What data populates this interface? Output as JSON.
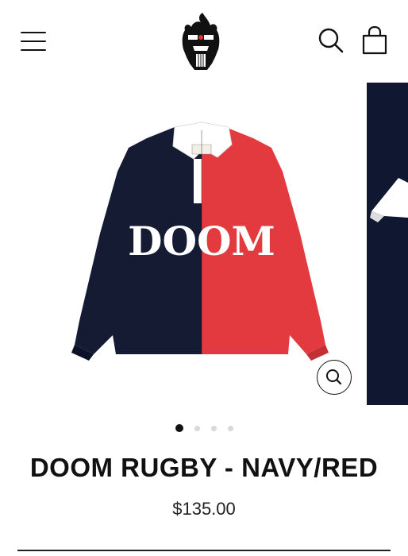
{
  "header": {
    "menu_icon": "hamburger-menu-icon",
    "logo_icon": "doom-mask-logo",
    "search_icon": "search-icon",
    "cart_icon": "shopping-bag-icon"
  },
  "product": {
    "image_text": "DOOM",
    "title": "DOOM RUGBY - NAVY/RED",
    "price": "$135.00",
    "colors": {
      "navy": "#141b33",
      "red": "#e23a3f"
    }
  },
  "gallery": {
    "slide_count": 4,
    "active_slide": 1,
    "zoom_icon": "zoom-in-icon"
  }
}
